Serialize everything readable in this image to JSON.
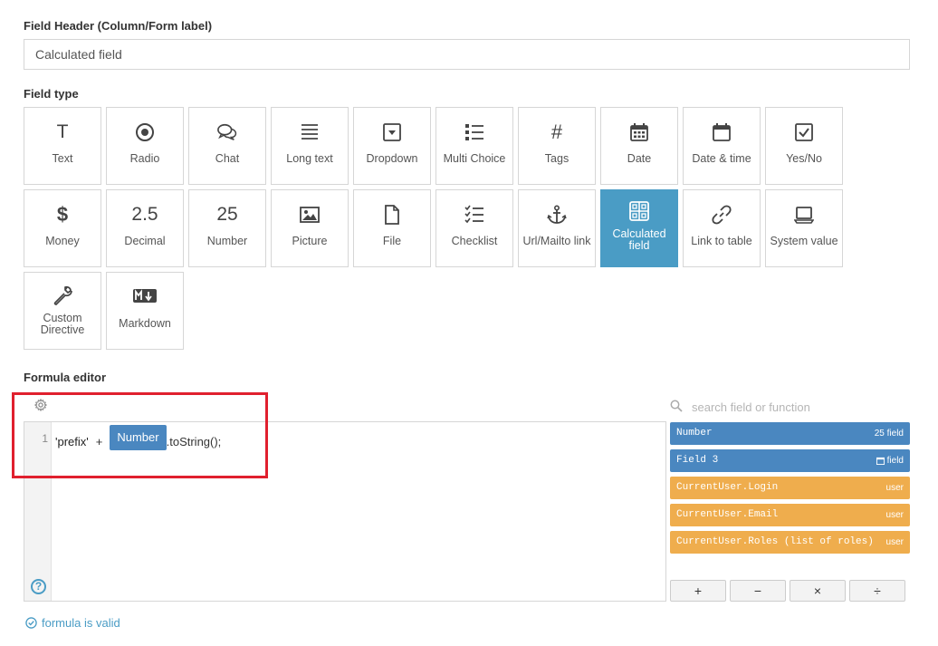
{
  "field_header": {
    "label": "Field Header (Column/Form label)",
    "value": "Calculated field"
  },
  "field_type": {
    "label": "Field type",
    "selected": "Calculated field",
    "types": [
      {
        "label": "Text",
        "icon": "text-icon"
      },
      {
        "label": "Radio",
        "icon": "radio-icon"
      },
      {
        "label": "Chat",
        "icon": "chat-icon"
      },
      {
        "label": "Long text",
        "icon": "long-text-icon"
      },
      {
        "label": "Dropdown",
        "icon": "dropdown-icon"
      },
      {
        "label": "Multi Choice",
        "icon": "multi-choice-icon"
      },
      {
        "label": "Tags",
        "icon": "hashtag-icon"
      },
      {
        "label": "Date",
        "icon": "calendar-icon"
      },
      {
        "label": "Date & time",
        "icon": "calendar-empty-icon"
      },
      {
        "label": "Yes/No",
        "icon": "checkbox-icon"
      },
      {
        "label": "Money",
        "icon": "dollar-icon"
      },
      {
        "label": "Decimal",
        "icon": "decimal-icon",
        "glyph": "2.5"
      },
      {
        "label": "Number",
        "icon": "number-icon",
        "glyph": "25"
      },
      {
        "label": "Picture",
        "icon": "picture-icon"
      },
      {
        "label": "File",
        "icon": "file-icon"
      },
      {
        "label": "Checklist",
        "icon": "checklist-icon"
      },
      {
        "label": "Url/Mailto link",
        "icon": "anchor-icon"
      },
      {
        "label": "Calculated field",
        "icon": "calculator-icon"
      },
      {
        "label": "Link to table",
        "icon": "link-icon"
      },
      {
        "label": "System value",
        "icon": "laptop-icon"
      },
      {
        "label": "Custom Directive",
        "icon": "wrench-icon"
      },
      {
        "label": "Markdown",
        "icon": "markdown-icon"
      }
    ]
  },
  "formula_editor": {
    "label": "Formula editor",
    "line_number": "1",
    "code": {
      "string_literal": "'prefix'",
      "operator": "+",
      "field_chip": "Number",
      "suffix": ".toString();"
    },
    "help_glyph": "?"
  },
  "sidebar": {
    "search_placeholder": "search field or function",
    "items": [
      {
        "name": "Number",
        "tag": "25 field",
        "kind": "field"
      },
      {
        "name": "Field 3",
        "tag": "field",
        "kind": "field",
        "tag_icon": "calendar-icon"
      },
      {
        "name": "CurrentUser.Login",
        "tag": "user",
        "kind": "user"
      },
      {
        "name": "CurrentUser.Email",
        "tag": "user",
        "kind": "user"
      },
      {
        "name": "CurrentUser.Roles (list of roles)",
        "tag": "user",
        "kind": "user"
      }
    ],
    "operators": [
      "+",
      "−",
      "×",
      "÷"
    ]
  },
  "status": {
    "text": "formula is valid"
  },
  "colors": {
    "accent": "#4a9cc5",
    "field_chip": "#4a87c0",
    "user_chip": "#efad4d",
    "highlight": "#e0202e"
  }
}
